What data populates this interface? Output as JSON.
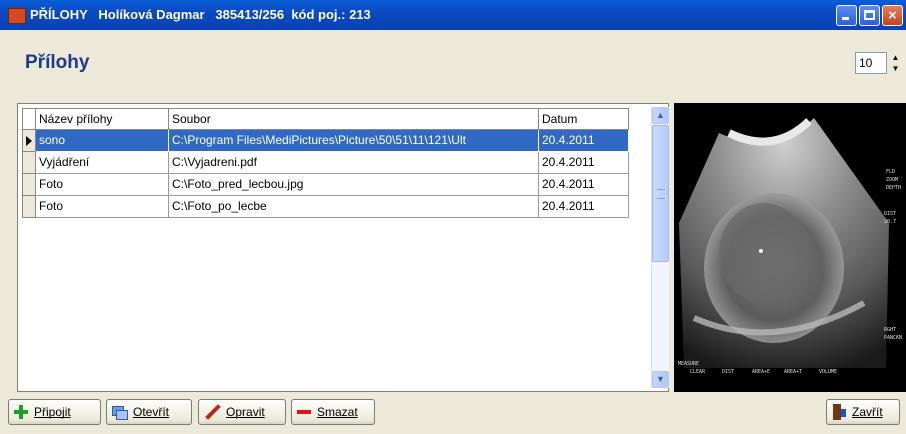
{
  "window": {
    "title": "PŘÍLOHY   Holíková Dagmar   385413/256  kód poj.: 213",
    "buttons": {
      "minimize": "minimize",
      "maximize": "maximize",
      "close": "×"
    }
  },
  "page": {
    "title": "Přílohy"
  },
  "spinner": {
    "value": "10",
    "up": "▲",
    "down": "▼"
  },
  "table": {
    "columns": [
      "Název přílohy",
      "Soubor",
      "Datum"
    ],
    "rows": [
      {
        "name": "sono",
        "file": "C:\\Program Files\\MediPictures\\Picture\\50\\51\\11\\121\\Ult",
        "date": "20.4.2011",
        "selected": true
      },
      {
        "name": "Vyjádření",
        "file": "C:\\Vyjadreni.pdf",
        "date": "20.4.2011",
        "selected": false
      },
      {
        "name": "Foto",
        "file": "C:\\Foto_pred_lecbou.jpg",
        "date": "20.4.2011",
        "selected": false
      },
      {
        "name": "Foto",
        "file": "C:\\Foto_po_lecbe",
        "date": "20.4.2011",
        "selected": false
      }
    ]
  },
  "scrollbar": {
    "up": "▲",
    "down": "▼"
  },
  "preview": {
    "image": "ultrasound-scan",
    "lines": [
      "CLEAR",
      "DIST",
      "AREA+E",
      "AREA+T",
      "VOLUME"
    ]
  },
  "toolbar": {
    "attach_label": "Připojit",
    "open_label": "Otevřít",
    "edit_label": "Opravit",
    "delete_label": "Smazat",
    "close_label": "Zavřít"
  },
  "colors": {
    "title_bar": "#0b49c2",
    "selection": "#316ac5",
    "page_title": "#1f3a8a",
    "face": "#ece9d8"
  }
}
